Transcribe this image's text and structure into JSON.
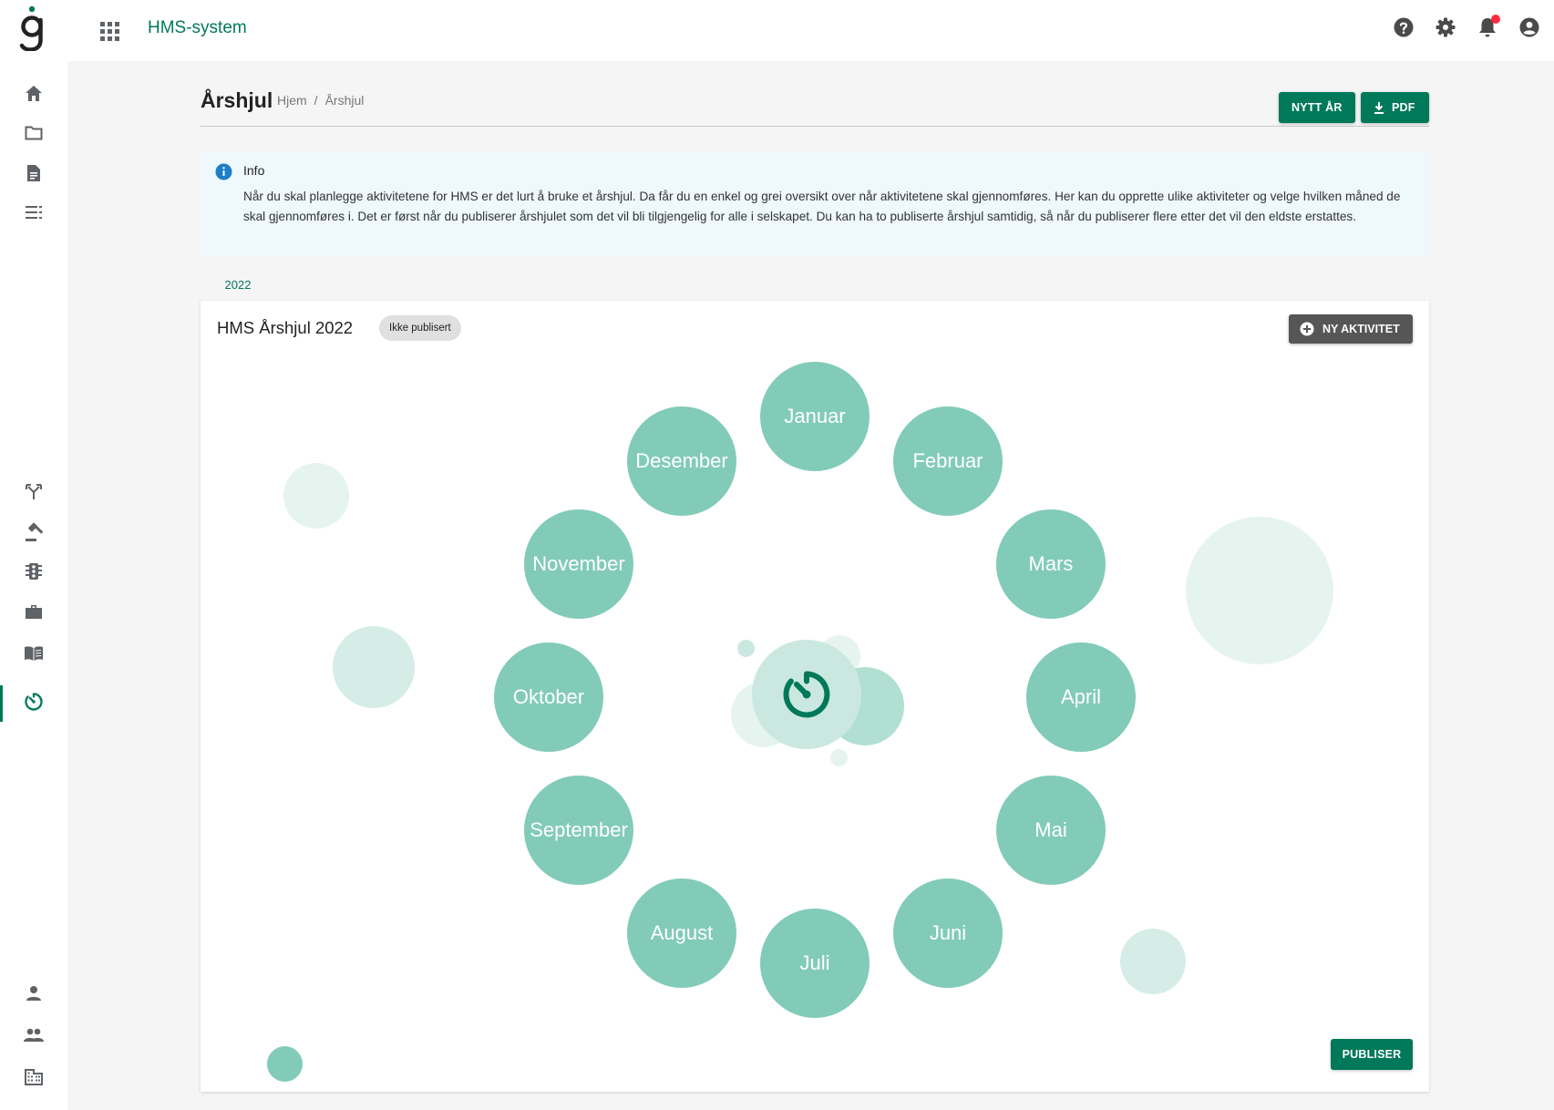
{
  "topbar": {
    "app_title": "HMS-system",
    "icons": [
      "help-icon",
      "gear-icon",
      "bell-icon",
      "account-icon"
    ],
    "notification_dot_color": "#ff2a3d"
  },
  "sidebar": {
    "items": [
      "home-icon",
      "folder-icon",
      "document-icon",
      "checklist-icon",
      "fork-icon",
      "gavel-icon",
      "traffic-light-icon",
      "briefcase-icon",
      "book-icon",
      "timer-icon",
      "person-icon",
      "people-icon",
      "building-icon"
    ],
    "active": "timer-icon"
  },
  "header": {
    "title": "Årshjul",
    "breadcrumb": [
      "Hjem",
      "Årshjul"
    ],
    "breadcrumb_sep": "/",
    "new_year_label": "NYTT ÅR",
    "pdf_label": "PDF"
  },
  "info": {
    "title": "Info",
    "text": "Når du skal planlegge aktivitetene for HMS er det lurt å bruke et årshjul. Da får du en enkel og grei oversikt over når aktivitetene skal gjennomføres. Her kan du opprette ulike aktiviteter og velge hvilken måned de skal gjennomføres i. Det er først når du publiserer årshjulet som det vil bli tilgjengelig for alle i selskapet. Du kan ha to publiserte årshjul samtidig, så når du publiserer flere etter det vil den eldste erstattes."
  },
  "tabs": [
    {
      "label": "2022",
      "active": true
    }
  ],
  "wheel": {
    "title": "HMS Årshjul 2022",
    "status": "Ikke publisert",
    "new_activity_label": "NY AKTIVITET",
    "publish_label": "PUBLISER",
    "months": [
      "Januar",
      "Februar",
      "Mars",
      "April",
      "Mai",
      "Juni",
      "Juli",
      "August",
      "September",
      "Oktober",
      "November",
      "Desember"
    ],
    "month_color": "#82cbb9",
    "center_icon": "timer-icon"
  },
  "colors": {
    "brand": "#00795b",
    "info_bg": "#eef8fd",
    "dark_button": "#565656"
  }
}
